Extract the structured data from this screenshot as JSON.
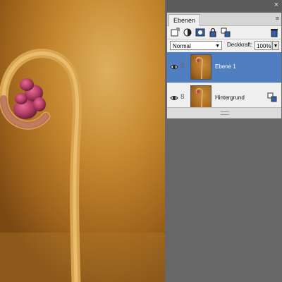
{
  "panel": {
    "tab_label": "Ebenen",
    "menu_glyph": "≡",
    "close_glyph": "×"
  },
  "toolbar": {
    "icons": [
      "new-layer-icon",
      "adjustment-layer-icon",
      "layer-mask-icon",
      "lock-icon",
      "link-layers-icon",
      "trash-icon"
    ]
  },
  "options": {
    "blend_mode": "Normal",
    "opacity_label": "Deckkraft:",
    "opacity_value": "100%"
  },
  "layers": [
    {
      "name": "Ebene 1",
      "selected": true,
      "visible": true
    },
    {
      "name": "Hintergrund",
      "selected": false,
      "visible": true
    }
  ],
  "colors": {
    "selection": "#4f7fc0",
    "panel_bg": "#efefef",
    "workspace": "#676767"
  }
}
